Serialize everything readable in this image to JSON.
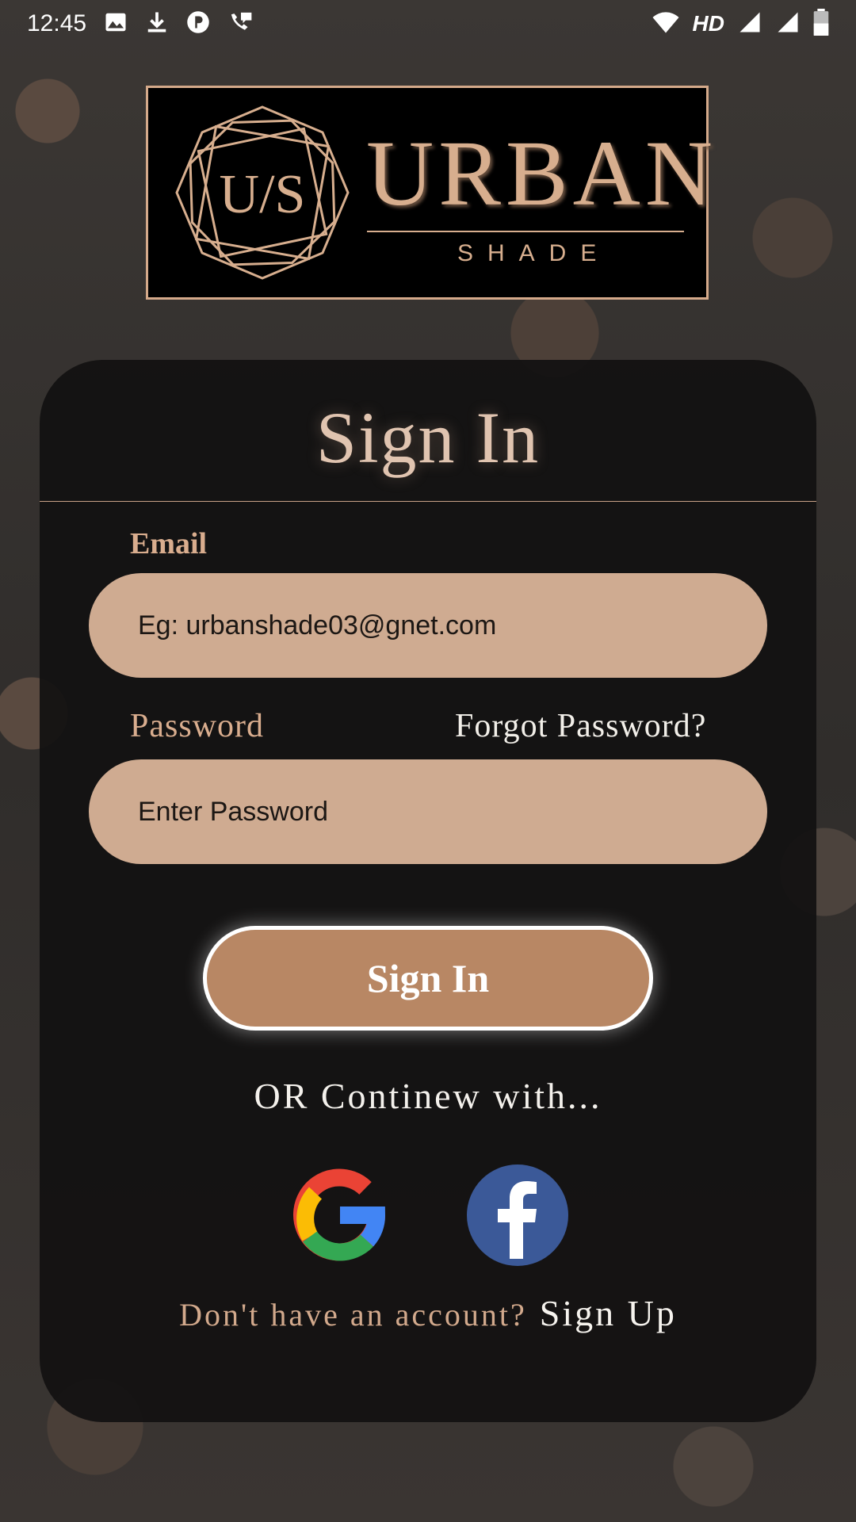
{
  "status_bar": {
    "time": "12:45",
    "network_label": "HD",
    "left_icons": [
      "image-icon",
      "download-icon",
      "parking-icon",
      "phone-chat-icon"
    ],
    "right_icons": [
      "wifi-icon",
      "signal-icon",
      "signal-icon",
      "battery-icon"
    ]
  },
  "logo": {
    "monogram": "U/S",
    "brand": "URBAN",
    "sub": "SHADE"
  },
  "form": {
    "title": "Sign In",
    "email_label": "Email",
    "email_placeholder": "Eg: urbanshade03@gnet.com",
    "password_label": "Password",
    "forgot_label": "Forgot Password?",
    "password_placeholder": "Enter Password",
    "signin_button": "Sign In",
    "or_text": "OR Continew with...",
    "social": [
      "google-icon",
      "facebook-icon"
    ],
    "no_account_text": "Don't have an account?",
    "signup_link": "Sign Up"
  },
  "colors": {
    "accent": "#d7ae8e",
    "field_bg": "#cfab91",
    "button_bg": "#b88764",
    "card_bg": "#121111"
  }
}
